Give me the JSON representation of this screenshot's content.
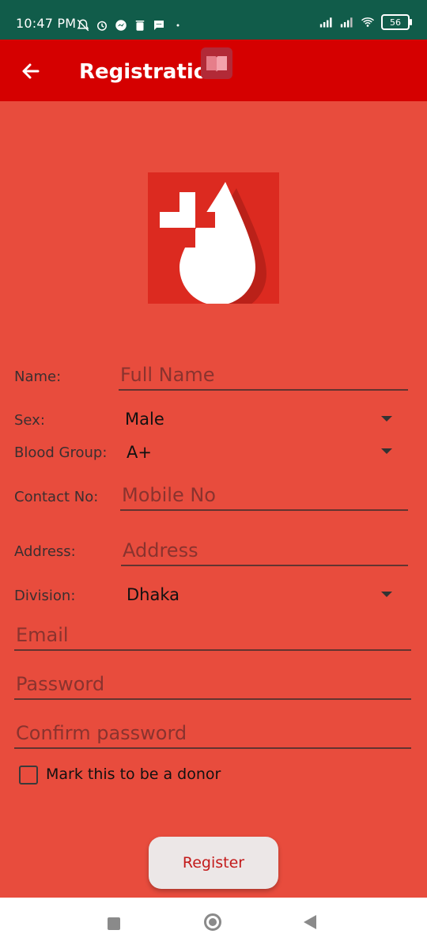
{
  "status_bar": {
    "time": "10:47 PM",
    "battery": "56",
    "icons": [
      "notifications-muted-icon",
      "alarm-icon",
      "messenger-icon",
      "delete-icon",
      "message-icon",
      "dot-icon"
    ],
    "right_icons": [
      "signal-icon",
      "signal-icon-2",
      "wifi-icon",
      "battery-icon"
    ]
  },
  "app_bar": {
    "title": "Registration",
    "back_icon": "arrow-back-icon",
    "badge_icon": "book-icon"
  },
  "form": {
    "name": {
      "label": "Name:",
      "placeholder": "Full Name"
    },
    "sex": {
      "label": "Sex:",
      "value": "Male"
    },
    "blood_group": {
      "label": "Blood Group:",
      "value": "A+"
    },
    "contact": {
      "label": "Contact No:",
      "placeholder": "Mobile No"
    },
    "address": {
      "label": "Address:",
      "placeholder": "Address"
    },
    "division": {
      "label": "Division:",
      "value": "Dhaka"
    },
    "email": {
      "placeholder": "Email"
    },
    "password": {
      "placeholder": "Password"
    },
    "confirm_password": {
      "placeholder": "Confirm password"
    },
    "donor_checkbox_label": "Mark this to be a donor",
    "donor_checked": false,
    "register_label": "Register"
  },
  "colors": {
    "status_bar": "#115c4a",
    "app_bar": "#d50000",
    "background": "#e84c3d",
    "button_text": "#c31a1a"
  }
}
